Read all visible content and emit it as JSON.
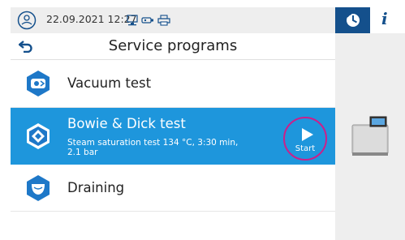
{
  "status_bar": {
    "datetime": "22.09.2021 12:27",
    "icons": [
      "device-logo-icon",
      "monitor-icon",
      "usb-stick-icon",
      "printer-icon"
    ]
  },
  "right_panel": {
    "tabs": [
      {
        "icon": "service-program-icon",
        "active": true
      },
      {
        "label": "i",
        "icon": "info-icon",
        "active": false
      }
    ],
    "device_image": "autoclave-device-icon"
  },
  "header": {
    "title": "Service programs",
    "back_icon": "back-arrow-icon"
  },
  "programs": [
    {
      "label": "Vacuum test",
      "icon": "vacuum-test-icon",
      "selected": false
    },
    {
      "label": "Bowie & Dick test",
      "icon": "bowie-dick-test-icon",
      "selected": true,
      "description": "Steam saturation test 134 °C, 3:30 min, 2.1 bar",
      "start_label": "Start"
    },
    {
      "label": "Draining",
      "icon": "draining-icon",
      "selected": false
    }
  ],
  "colors": {
    "primary": "#14508c",
    "selected_row": "#1e96dc",
    "highlight_circle": "#cc1f8a",
    "panel_bg": "#eeeeee"
  }
}
